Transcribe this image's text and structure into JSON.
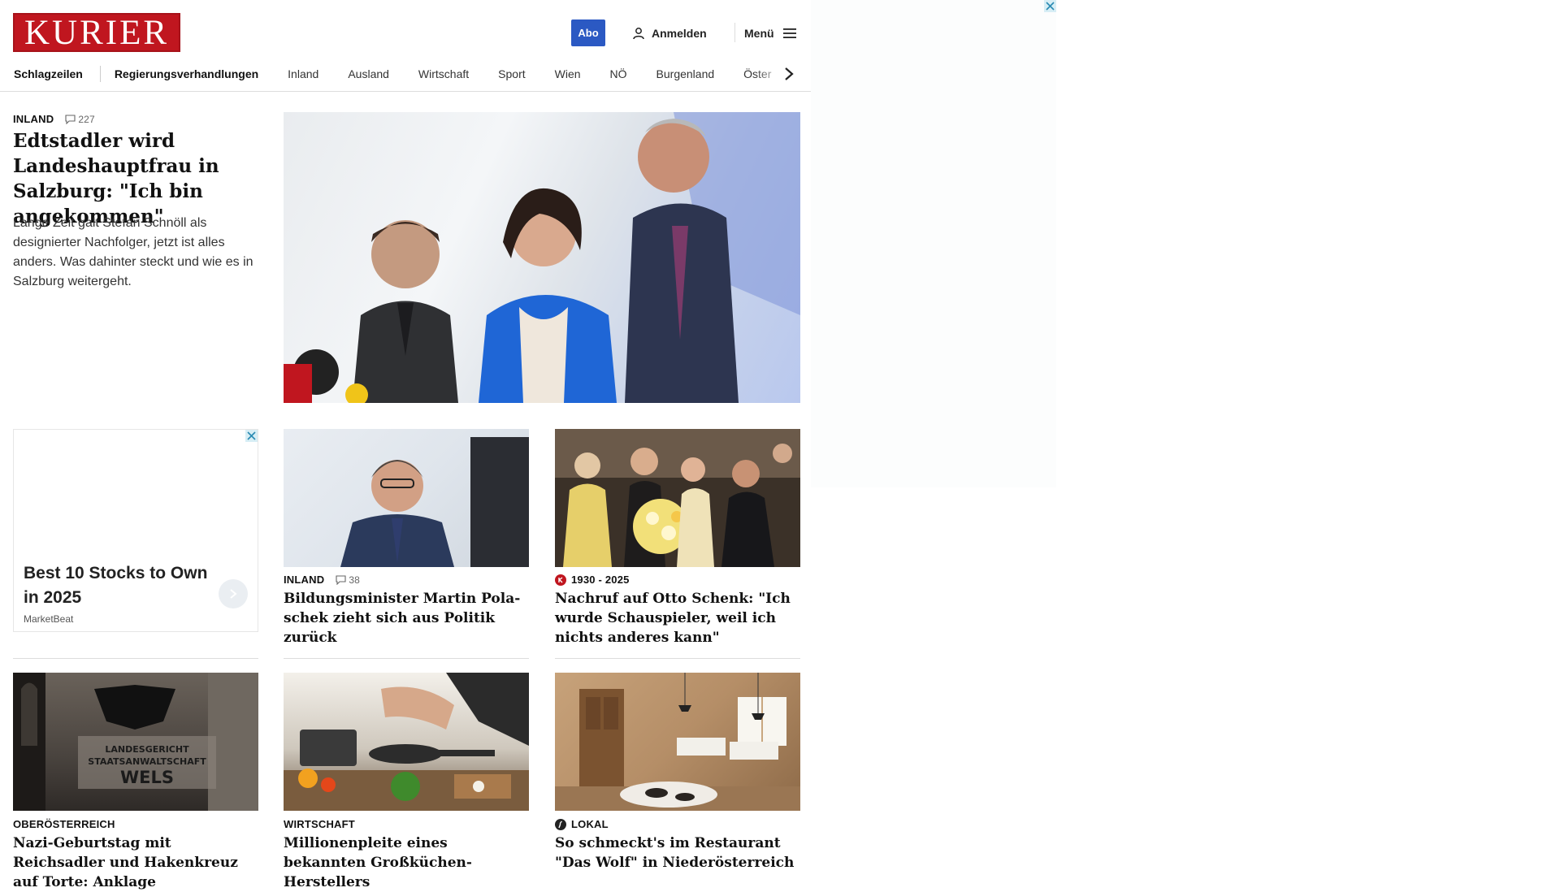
{
  "brand": {
    "logo_text": "KURIER",
    "color": "#c0161f",
    "accent": "#2b59c3"
  },
  "header": {
    "abo_label": "Abo",
    "login_label": "Anmelden",
    "login_icon": "user-icon",
    "menu_label": "Menü",
    "menu_icon": "hamburger-icon"
  },
  "nav": {
    "items": [
      "Schlagzeilen",
      "Regierungsverhandlungen",
      "Inland",
      "Ausland",
      "Wirtschaft",
      "Sport",
      "Wien",
      "NÖ",
      "Burgenland",
      "Öster"
    ],
    "next_icon": "chevron-right-icon"
  },
  "lead": {
    "kicker": "INLAND",
    "comments": "227",
    "headline": "Edtstadler wird Landes­hauptfrau in Salzburg: \"Ich bin angekommen\"",
    "teaser": "Lange Zeit galt Stefan Schnöll als designierter Nachfolger, jetzt ist alles anders. Was dahinter steckt und wie es in Salzburg weitergeht."
  },
  "ad": {
    "title": "Best 10 Stocks to Own in 2025",
    "source": "MarketBeat"
  },
  "cards": [
    {
      "kicker": "INLAND",
      "comments": "38",
      "headline": "Bildungsminister Martin Pola­schek zieht sich aus Politik zurück"
    },
    {
      "kicker": "1930 - 2025",
      "kicker_icon": "kurier-badge-icon",
      "headline": "Nachruf auf Otto Schenk: \"Ich wurde Schauspieler, weil ich nichts anderes kann\""
    },
    {
      "kicker": "OBERÖSTERREICH",
      "headline": "Nazi-Geburtstag mit Reichsadler und Hakenkreuz auf Torte: Anklage"
    },
    {
      "kicker": "WIRTSCHAFT",
      "headline": "Millionenpleite eines bekannten Großküchen-Herstellers"
    },
    {
      "kicker": "LOKAL",
      "kicker_icon": "lokal-badge-icon",
      "headline": "So schmeckt's im Restaurant \"Das Wolf\" in Niederösterreich"
    }
  ]
}
